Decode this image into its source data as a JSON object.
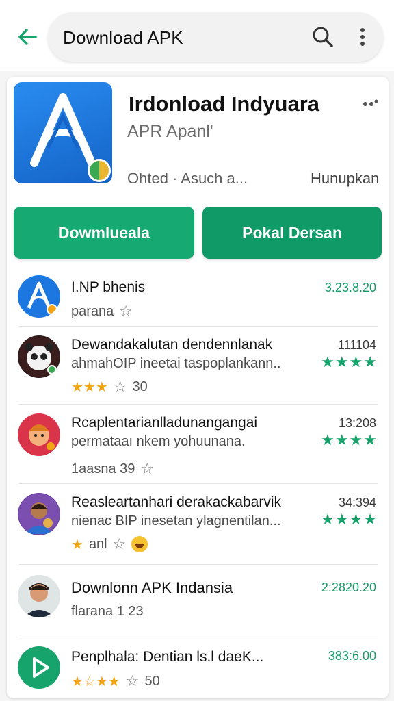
{
  "search": {
    "query": "Download APK"
  },
  "colors": {
    "accent": "#16a971",
    "accent_dark": "#0f9a67",
    "icon_blue": "#1c77e0",
    "star_yellow": "#f1a516"
  },
  "app": {
    "title": "Irdonload Indyuara",
    "subtitle": "APR Apanl'",
    "meta_left": "Ohted · Asuch a...",
    "meta_right": "Hunupkan",
    "primary_button": "Dowmlueala",
    "secondary_button": "Pokal Dersan"
  },
  "list": [
    {
      "title": "I.NP bhenis",
      "sub": "",
      "meta": "parana",
      "right": "3.23.8.20",
      "stars": "",
      "icon": "app-a-icon"
    },
    {
      "title": "Dewandakalutan dendennlanak",
      "sub": "ahmahOIP ineetai taspoplankann..",
      "meta": "30",
      "right": "111104",
      "stars": "★★★★",
      "icon": "panda-avatar"
    },
    {
      "title": "Rcaplentarianlladunangangai",
      "sub": "permataaı nkem yohuunana.",
      "meta": "1aasna 39",
      "right": "13:208",
      "stars": "★★★★",
      "icon": "cartoon-avatar"
    },
    {
      "title": "Reasleartanhari derakackabarvik",
      "sub": "nienac BIP inesetan ylagnentilan...",
      "meta": "anl",
      "right": "34:394",
      "stars": "★★★★",
      "icon": "boy-avatar"
    },
    {
      "title": "Downlonn APK Indansia",
      "sub": "",
      "meta": "flarana  1  23",
      "right": "2:2820.20",
      "stars": "",
      "icon": "man-avatar"
    },
    {
      "title": "Penplhala: Dentian ls.l daeK...",
      "sub": "",
      "meta": "50",
      "right": "383:6.00",
      "stars": "",
      "icon": "play-icon"
    }
  ]
}
